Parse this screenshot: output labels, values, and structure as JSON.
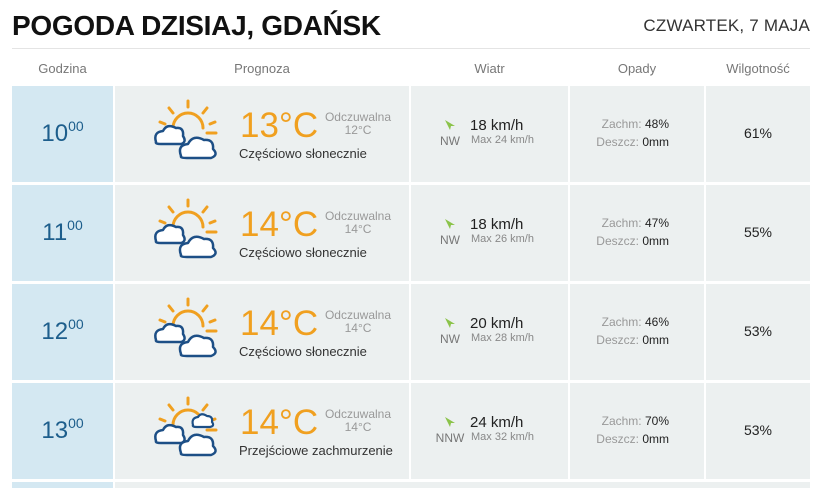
{
  "header": {
    "title": "POGODA DZISIAJ, GDAŃSK",
    "date": "CZWARTEK, 7 MAJA"
  },
  "columns": {
    "hour": "Godzina",
    "forecast": "Prognoza",
    "wind": "Wiatr",
    "precip": "Opady",
    "humidity": "Wilgotność"
  },
  "colors": {
    "hour_bg": "#d4e8f2",
    "cell_bg": "#ecf0f0",
    "temp": "#f0a020",
    "hour_text": "#1d5e8c",
    "wind_arrow": "#8bc34a"
  },
  "rows": [
    {
      "hour": "10",
      "minutes": "00",
      "icon": "partly-sunny-icon",
      "temp": "13°C",
      "feels_label": "Odczuwalna",
      "feels_value": "12°C",
      "condition": "Częściowo słonecznie",
      "wind_dir": "NW",
      "wind_speed": "18 km/h",
      "wind_max": "Max 24 km/h",
      "cloud_label": "Zachm:",
      "cloud": "48%",
      "rain_label": "Deszcz:",
      "rain": "0mm",
      "humidity": "61%"
    },
    {
      "hour": "11",
      "minutes": "00",
      "icon": "partly-sunny-icon",
      "temp": "14°C",
      "feels_label": "Odczuwalna",
      "feels_value": "14°C",
      "condition": "Częściowo słonecznie",
      "wind_dir": "NW",
      "wind_speed": "18 km/h",
      "wind_max": "Max 26 km/h",
      "cloud_label": "Zachm:",
      "cloud": "47%",
      "rain_label": "Deszcz:",
      "rain": "0mm",
      "humidity": "55%"
    },
    {
      "hour": "12",
      "minutes": "00",
      "icon": "partly-sunny-icon",
      "temp": "14°C",
      "feels_label": "Odczuwalna",
      "feels_value": "14°C",
      "condition": "Częściowo słonecznie",
      "wind_dir": "NW",
      "wind_speed": "20 km/h",
      "wind_max": "Max 28 km/h",
      "cloud_label": "Zachm:",
      "cloud": "46%",
      "rain_label": "Deszcz:",
      "rain": "0mm",
      "humidity": "53%"
    },
    {
      "hour": "13",
      "minutes": "00",
      "icon": "variable-clouds-icon",
      "temp": "14°C",
      "feels_label": "Odczuwalna",
      "feels_value": "14°C",
      "condition": "Przejściowe zachmurzenie",
      "wind_dir": "NNW",
      "wind_speed": "24 km/h",
      "wind_max": "Max 32 km/h",
      "cloud_label": "Zachm:",
      "cloud": "70%",
      "rain_label": "Deszcz:",
      "rain": "0mm",
      "humidity": "53%"
    }
  ]
}
